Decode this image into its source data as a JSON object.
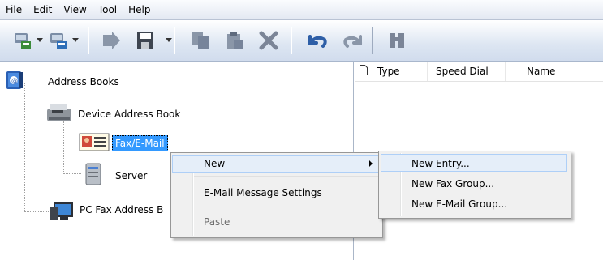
{
  "menubar": {
    "items": [
      "File",
      "Edit",
      "View",
      "Tool",
      "Help"
    ]
  },
  "toolbar": {
    "buttons": [
      "new-entry-icon",
      "new-group-icon",
      "properties-icon",
      "save-icon",
      "copy-icon",
      "paste-icon",
      "delete-icon",
      "undo-icon",
      "redo-icon",
      "find-icon"
    ]
  },
  "tree": {
    "root": "Address Books",
    "device_book": "Device Address Book",
    "fax_email": "Fax/E-Mail",
    "server": "Server",
    "pc_fax": "PC Fax Address B"
  },
  "list": {
    "columns": [
      "Type",
      "Speed Dial",
      "Name"
    ]
  },
  "context_menu": {
    "items": [
      "New",
      "E-Mail Message Settings",
      "Paste"
    ],
    "disabled": [
      "Paste"
    ]
  },
  "submenu": {
    "items": [
      "New Entry...",
      "New Fax Group...",
      "New E-Mail Group..."
    ]
  },
  "colors": {
    "selection": "#3399ff",
    "highlight_border": "#aecff7"
  }
}
